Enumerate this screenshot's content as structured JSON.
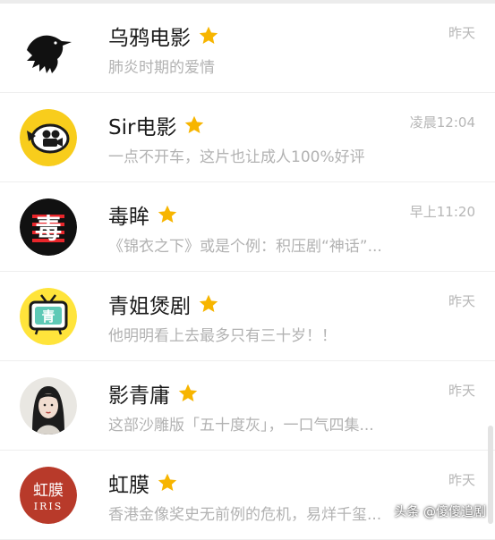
{
  "conversations": [
    {
      "name": "乌鸦电影",
      "preview": "肺炎时期的爱情",
      "time": "昨天",
      "avatar": "crow-icon",
      "starred": true
    },
    {
      "name": "Sir电影",
      "preview": "一点不开车，这片也让成人100%好评",
      "time": "凌晨12:04",
      "avatar": "film-camera-icon",
      "starred": true
    },
    {
      "name": "毒眸",
      "preview": "《锦衣之下》或是个例：积压剧“神话”...",
      "time": "早上11:20",
      "avatar": "dumou-logo-icon",
      "starred": true
    },
    {
      "name": "青姐煲剧",
      "preview": "他明明看上去最多只有三十岁！！",
      "time": "昨天",
      "avatar": "tv-icon",
      "starred": true
    },
    {
      "name": "影青庸",
      "preview": "这部沙雕版「五十度灰」，一口气四集...",
      "time": "昨天",
      "avatar": "portrait-icon",
      "starred": true
    },
    {
      "name": "虹膜",
      "preview": "香港金像奖史无前例的危机，易烊千玺...",
      "time": "昨天",
      "avatar": "iris-logo-icon",
      "starred": true
    }
  ],
  "avatar_text": {
    "dumou": "毒",
    "qing": "青",
    "iris_cn": "虹膜",
    "iris_en": "IRIS"
  },
  "watermark": "头条 @傻傻追剧",
  "colors": {
    "star": "#f7b500",
    "title": "#1a1a1a",
    "secondary": "#b2b2b2",
    "sir_yellow": "#f8cd1c",
    "iris_red": "#b83a2a",
    "tv_yellow": "#ffe43b"
  }
}
